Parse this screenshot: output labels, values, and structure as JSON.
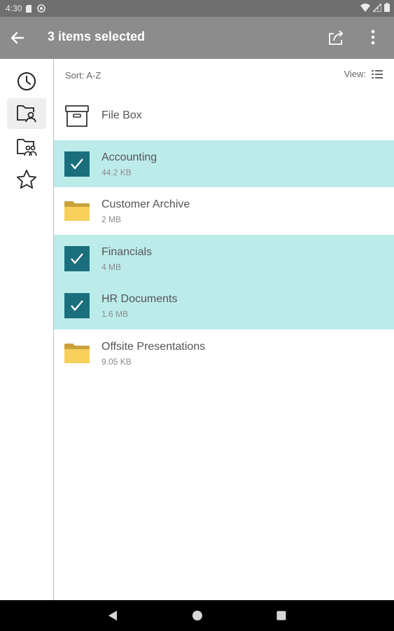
{
  "status_bar": {
    "time": "4:30"
  },
  "app_bar": {
    "title": "3 items selected"
  },
  "sort_bar": {
    "sort_label": "Sort: A-Z",
    "view_label": "View:"
  },
  "items": [
    {
      "name": "File Box",
      "size": "",
      "selected": false,
      "icon": "archive-box-icon"
    },
    {
      "name": "Accounting",
      "size": "44.2 KB",
      "selected": true,
      "icon": "check-icon"
    },
    {
      "name": "Customer Archive",
      "size": "2 MB",
      "selected": false,
      "icon": "folder-icon"
    },
    {
      "name": "Financials",
      "size": "4 MB",
      "selected": true,
      "icon": "check-icon"
    },
    {
      "name": "HR Documents",
      "size": "1.6 MB",
      "selected": true,
      "icon": "check-icon"
    },
    {
      "name": "Offsite Presentations",
      "size": "9.05 KB",
      "selected": false,
      "icon": "folder-icon"
    }
  ],
  "colors": {
    "selected_row": "#bcecea",
    "checkbox": "#1b6f7d",
    "folder": "#f7cf5a",
    "app_bar": "#8c8c8c"
  }
}
